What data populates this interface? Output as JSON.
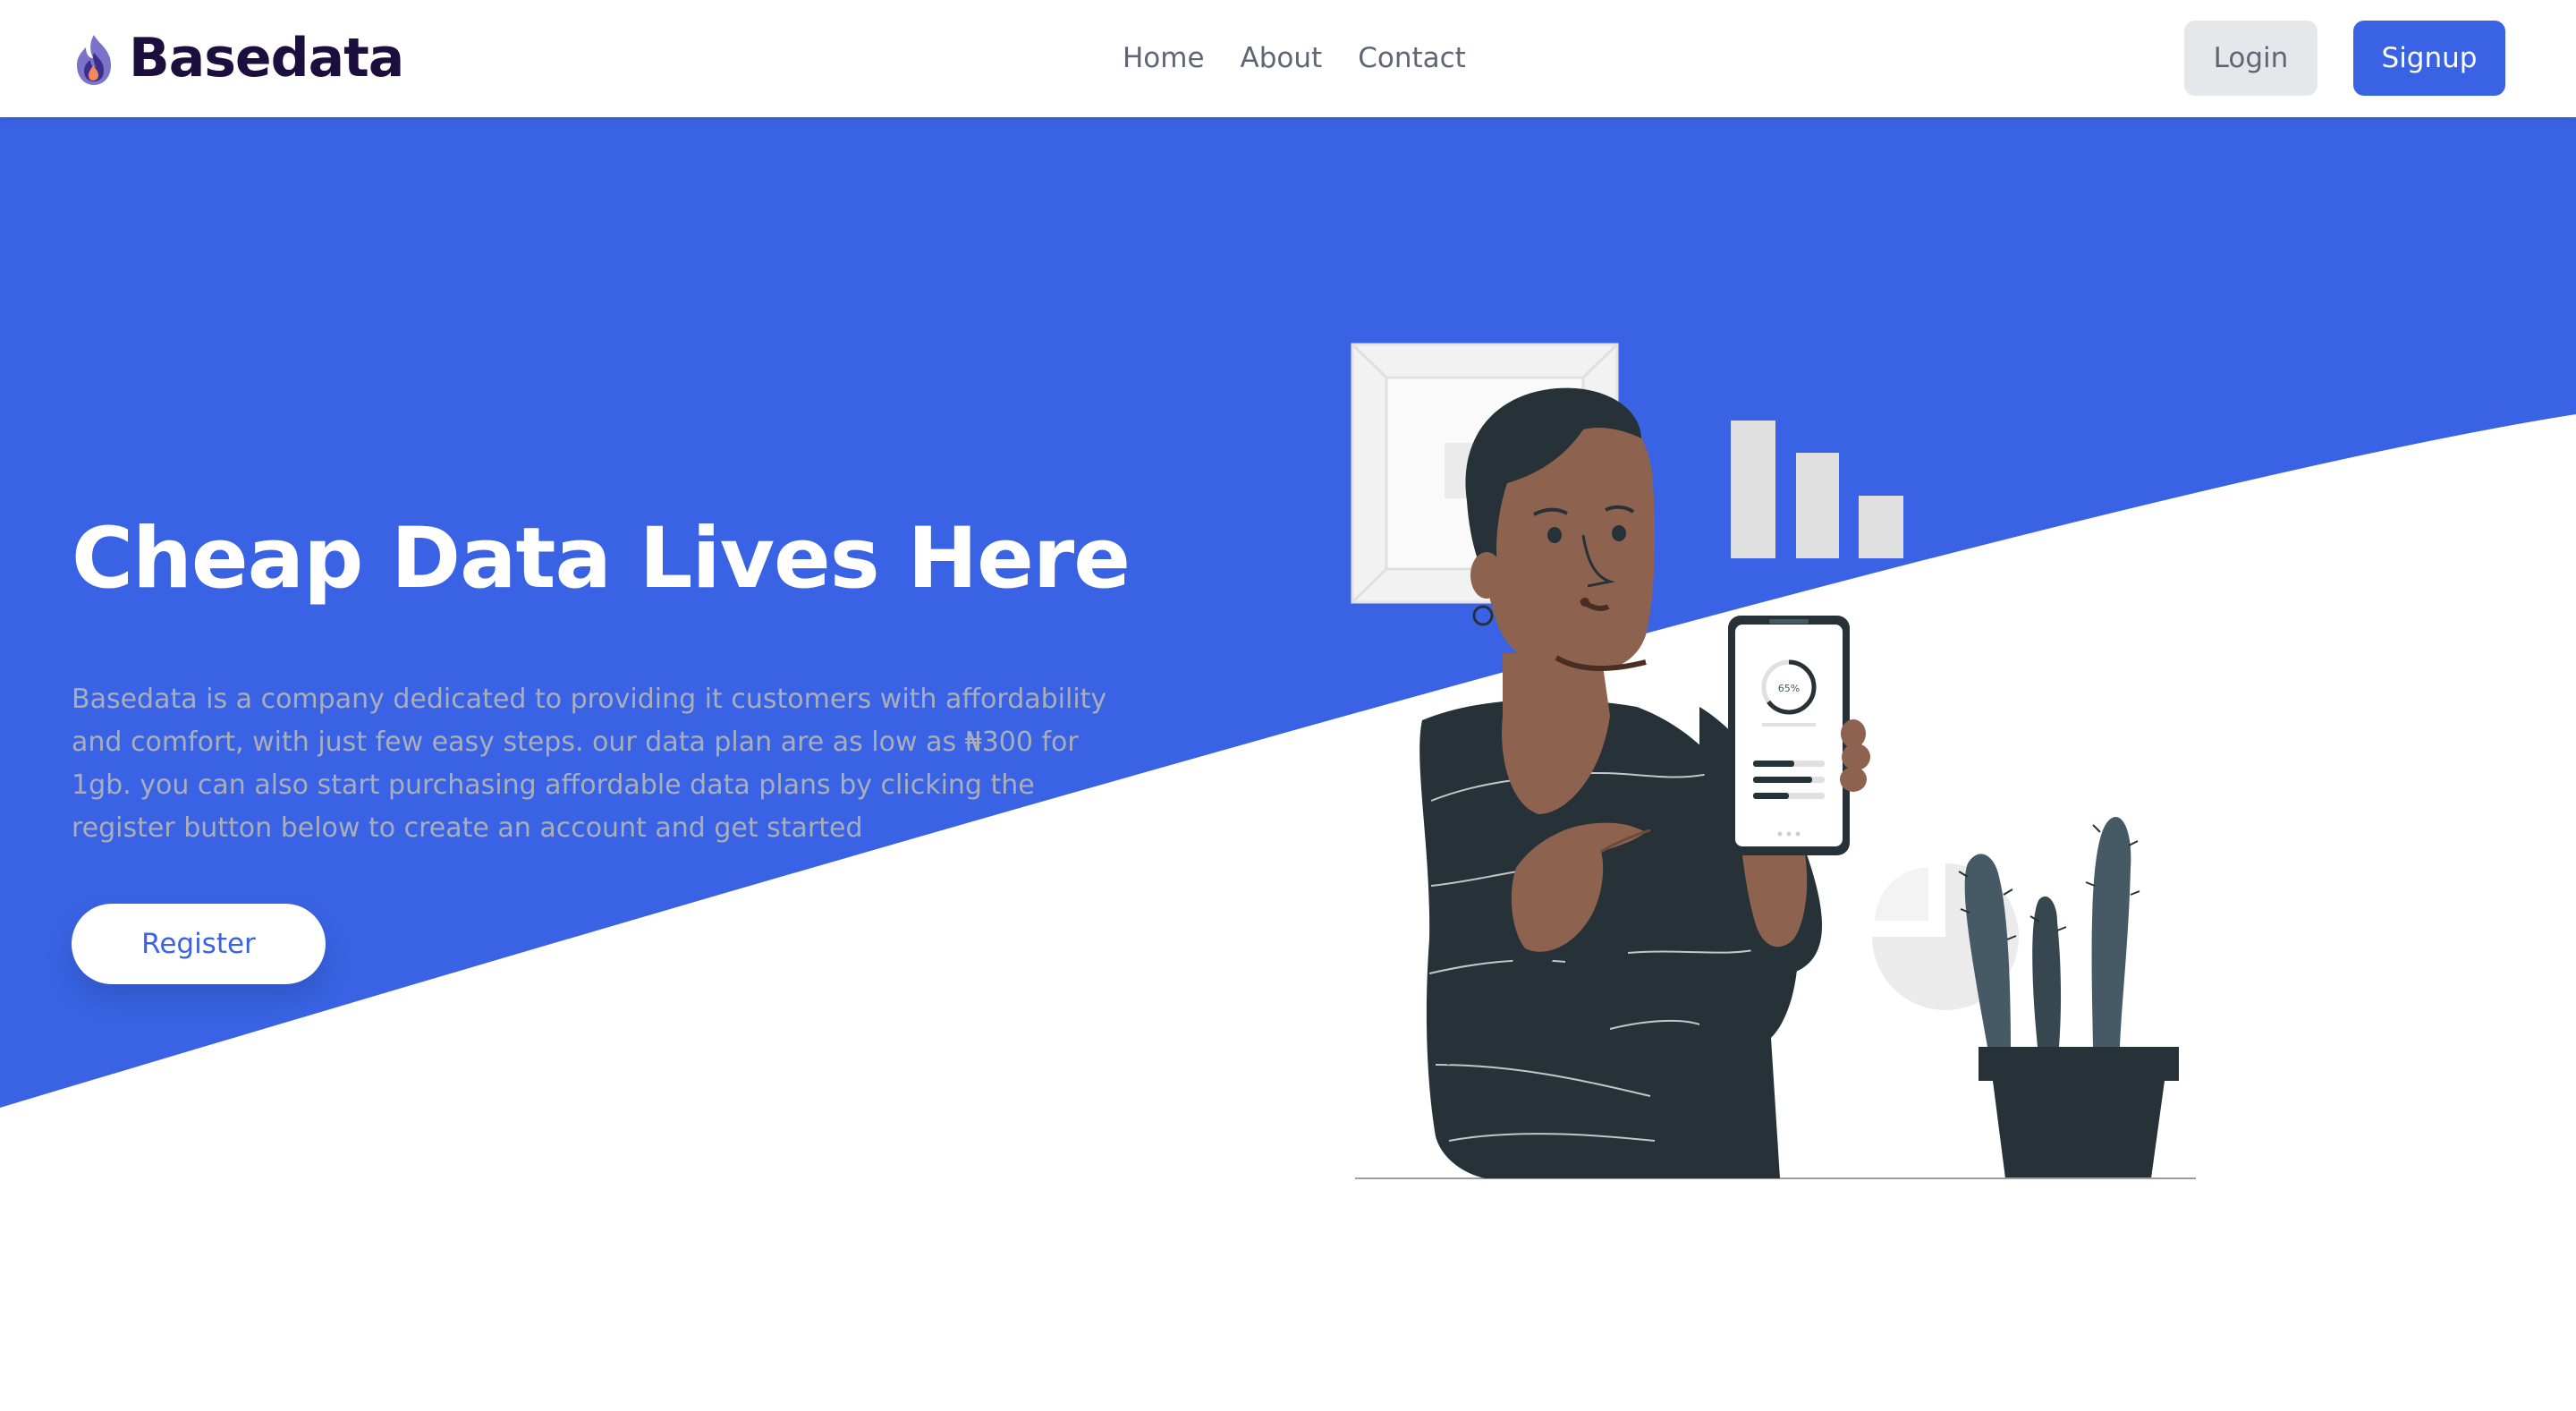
{
  "brand": {
    "name": "Basedata",
    "logo_icon": "flame-logo-icon"
  },
  "nav": {
    "links": [
      "Home",
      "About",
      "Contact"
    ],
    "login_label": "Login",
    "signup_label": "Signup"
  },
  "hero": {
    "title": "Cheap Data Lives Here",
    "description": "Basedata is a company dedicated to providing it customers with affordability and comfort, with just few easy steps. our data plan are as low as ₦300 for 1gb. you can also start purchasing affordable data plans by clicking the register button below to create an account and get started",
    "register_label": "Register"
  },
  "illustration": {
    "phone_progress_label": "65%",
    "phone_progress_fraction": 0.65,
    "subject": "person-holding-phone-illustration"
  },
  "colors": {
    "primary": "#3963e4",
    "brand_text": "#1d0f3d",
    "nav_text": "#5f6673",
    "login_bg": "#e5e7eb",
    "desc_text": "#a9aebb",
    "shirt": "#263238",
    "skin": "#8d6350"
  }
}
